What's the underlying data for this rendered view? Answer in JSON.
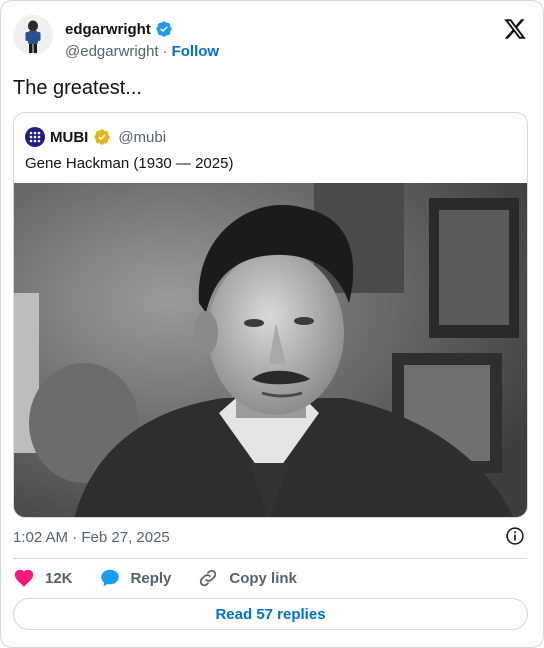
{
  "author": {
    "display_name": "edgarwright",
    "handle": "@edgarwright",
    "separator": "·",
    "follow_label": "Follow"
  },
  "tweet": {
    "text": "The greatest..."
  },
  "quoted": {
    "display_name": "MUBI",
    "handle": "@mubi",
    "text": "Gene Hackman (1930 — 2025)"
  },
  "meta": {
    "timestamp": "1:02 AM · Feb 27, 2025"
  },
  "actions": {
    "likes_count": "12K",
    "reply_label": "Reply",
    "copy_label": "Copy link"
  },
  "read_replies_label": "Read 57 replies",
  "colors": {
    "verified_blue": "#1d9bf0",
    "verified_gold": "#e2b719",
    "link_blue": "#006fd6",
    "like_pink": "#f91880",
    "mubi_navy": "#1f1f8a"
  },
  "icons": [
    "verified-badge-icon",
    "x-logo-icon",
    "info-icon",
    "heart-icon",
    "reply-bubble-icon",
    "link-icon",
    "mubi-logo-icon"
  ]
}
